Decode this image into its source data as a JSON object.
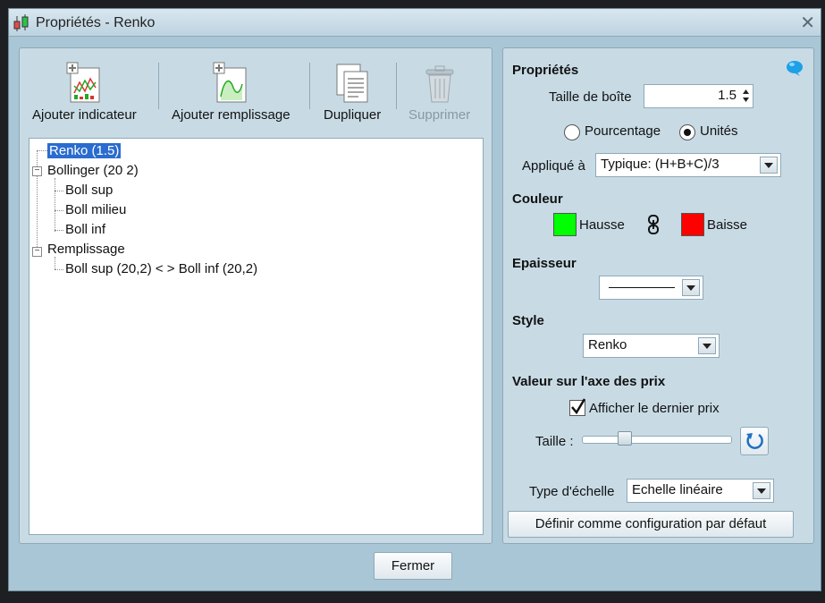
{
  "window": {
    "title": "Propriétés - Renko",
    "close_glyph": "✕"
  },
  "toolbar": {
    "add_indicator": "Ajouter indicateur",
    "add_fill": "Ajouter remplissage",
    "duplicate": "Dupliquer",
    "delete": "Supprimer"
  },
  "tree": {
    "nodes": [
      {
        "label": "Renko (1.5)",
        "selected": true
      },
      {
        "label": "Bollinger (20 2)",
        "expander": "−"
      },
      {
        "label": "Boll sup"
      },
      {
        "label": "Boll milieu"
      },
      {
        "label": "Boll inf"
      },
      {
        "label": "Remplissage",
        "expander": "−"
      },
      {
        "label": "Boll sup (20,2) < > Boll inf (20,2)"
      }
    ]
  },
  "props": {
    "heading": "Propriétés",
    "box_size_label": "Taille de boîte",
    "box_size_value": "1.5",
    "radio_percent": "Pourcentage",
    "radio_units": "Unités",
    "selected_radio": "units",
    "applied_label": "Appliqué à",
    "applied_value": "Typique: (H+B+C)/3",
    "color_heading": "Couleur",
    "up_label": "Hausse",
    "up_color": "#00ff00",
    "down_label": "Baisse",
    "down_color": "#ff0000",
    "thickness_heading": "Epaisseur",
    "style_heading": "Style",
    "style_value": "Renko",
    "price_axis_heading": "Valeur sur l'axe des prix",
    "show_last_price": "Afficher le dernier prix",
    "show_last_price_checked": true,
    "size_label": "Taille :",
    "scale_type_label": "Type d'échelle",
    "scale_type_value": "Echelle linéaire",
    "default_config_button": "Définir comme configuration par défaut"
  },
  "footer": {
    "close_button": "Fermer"
  },
  "colors": {
    "accent": "#2a6ccf",
    "panel": "#c8dbe5",
    "window_bg": "#a9c6d6"
  }
}
